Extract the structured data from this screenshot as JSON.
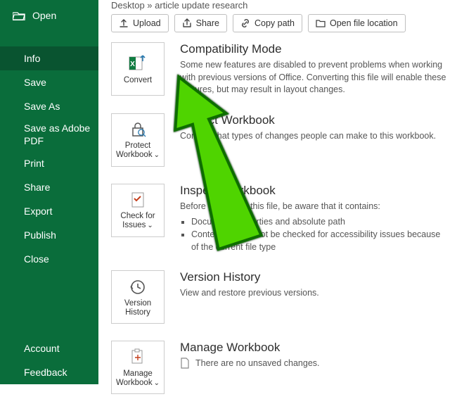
{
  "breadcrumb": "Desktop » article update research",
  "sidebar_open": "Open",
  "sidebar": {
    "items": [
      {
        "label": "Info"
      },
      {
        "label": "Save"
      },
      {
        "label": "Save As"
      },
      {
        "label": "Save as Adobe PDF"
      },
      {
        "label": "Print"
      },
      {
        "label": "Share"
      },
      {
        "label": "Export"
      },
      {
        "label": "Publish"
      },
      {
        "label": "Close"
      }
    ],
    "bottom": [
      {
        "label": "Account"
      },
      {
        "label": "Feedback"
      }
    ]
  },
  "toolbar": {
    "upload": "Upload",
    "share": "Share",
    "copypath": "Copy path",
    "openloc": "Open file location"
  },
  "tiles": {
    "convert": "Convert",
    "protect": "Protect Workbook",
    "check": "Check for Issues",
    "history": "Version History",
    "manage": "Manage Workbook"
  },
  "sections": {
    "compat": {
      "title": "Compatibility Mode",
      "desc": "Some new features are disabled to prevent problems when working with previous versions of Office. Converting this file will enable these features, but may result in layout changes."
    },
    "protect": {
      "title": "Protect Workbook",
      "desc": "Control what types of changes people can make to this workbook."
    },
    "inspect": {
      "title": "Inspect Workbook",
      "lead": "Before publishing this file, be aware that it contains:",
      "b1": "Document properties and absolute path",
      "b2": "Content that cannot be checked for accessibility issues because of the current file type"
    },
    "version": {
      "title": "Version History",
      "desc": "View and restore previous versions."
    },
    "manage": {
      "title": "Manage Workbook",
      "none": "There are no unsaved changes."
    }
  }
}
